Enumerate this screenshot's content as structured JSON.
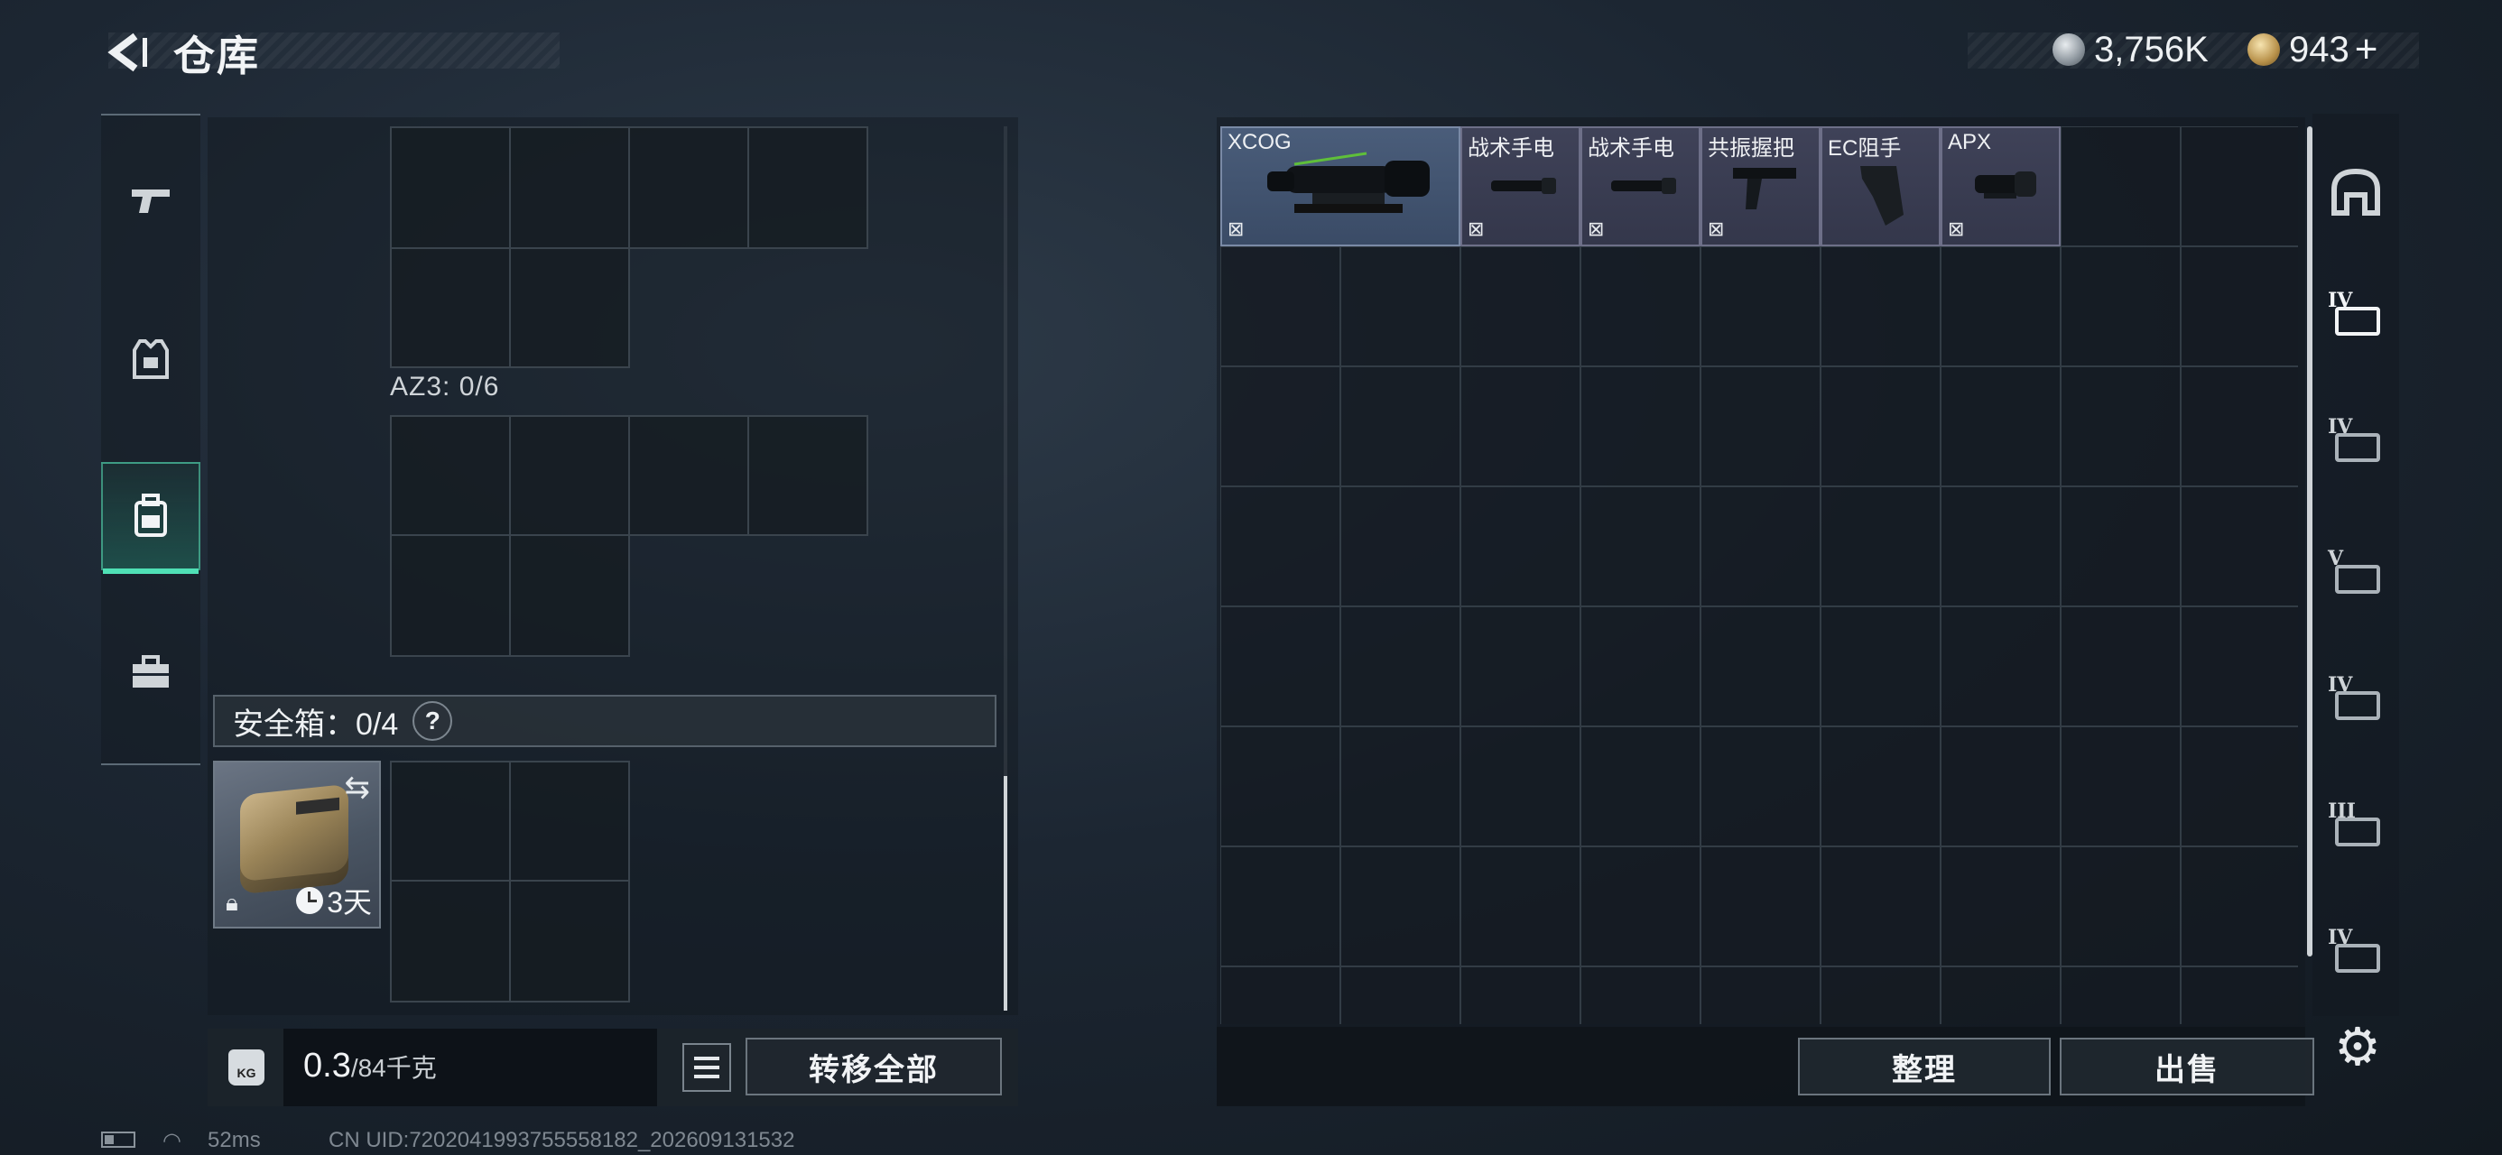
{
  "header": {
    "title": "仓库"
  },
  "currency": [
    {
      "icon": "silver-coin-icon",
      "value": "3,756K"
    },
    {
      "icon": "gold-coin-icon",
      "value": "943"
    }
  ],
  "left_nav": [
    "gun-icon",
    "vest-icon",
    "backpack-icon",
    "toolbox-icon"
  ],
  "left_panel": {
    "az3_label": "AZ3: 0/6",
    "safe_label": "安全箱：0/4",
    "help": "?",
    "safebox_days": "3天"
  },
  "weight": {
    "value": "0.3",
    "unit": "/84千克",
    "kg_label": "KG"
  },
  "buttons": {
    "transfer_all": "转移全部",
    "sort": "整理",
    "sell": "出售"
  },
  "items": [
    {
      "name": "XCOG"
    },
    {
      "name": "战术手电"
    },
    {
      "name": "战术手电"
    },
    {
      "name": "共振握把"
    },
    {
      "name": "EC阻手"
    },
    {
      "name": "APX"
    }
  ],
  "right_nav": [
    {
      "level": "",
      "icon": "helmet-icon"
    },
    {
      "level": "IV",
      "icon": "scope-attachment-icon"
    },
    {
      "level": "IV",
      "icon": "magazine-attachment-icon"
    },
    {
      "level": "V",
      "icon": "chip-icon"
    },
    {
      "level": "IV",
      "icon": "chip-icon"
    },
    {
      "level": "III",
      "icon": "chip-icon"
    },
    {
      "level": "IV",
      "icon": "tag-icon"
    }
  ],
  "status": {
    "ping": "52ms",
    "uid": "CN UID:7202041993755558182_202609131532"
  },
  "colors": {
    "accent": "#4fe0b5",
    "item_bg": "#3f4258"
  }
}
